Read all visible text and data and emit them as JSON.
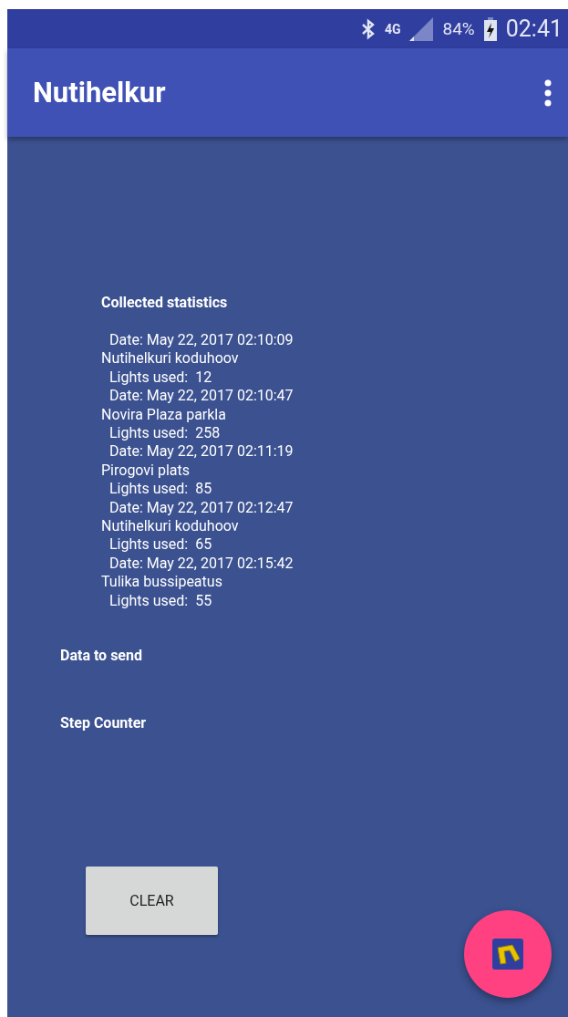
{
  "status_bar": {
    "network": "4G",
    "battery": "84%",
    "time": "02:41"
  },
  "app_bar": {
    "title": "Nutihelkur"
  },
  "statistics": {
    "title": "Collected statistics",
    "lines": [
      {
        "kind": "detail",
        "text": "Date: May 22, 2017 02:10:09"
      },
      {
        "kind": "place",
        "text": "Nutihelkuri koduhoov"
      },
      {
        "kind": "detail",
        "text": "Lights used:  12"
      },
      {
        "kind": "detail",
        "text": "Date: May 22, 2017 02:10:47"
      },
      {
        "kind": "place",
        "text": "Novira Plaza parkla"
      },
      {
        "kind": "detail",
        "text": "Lights used:  258"
      },
      {
        "kind": "detail",
        "text": "Date: May 22, 2017 02:11:19"
      },
      {
        "kind": "place",
        "text": "Pirogovi plats"
      },
      {
        "kind": "detail",
        "text": "Lights used:  85"
      },
      {
        "kind": "detail",
        "text": "Date: May 22, 2017 02:12:47"
      },
      {
        "kind": "place",
        "text": "Nutihelkuri koduhoov"
      },
      {
        "kind": "detail",
        "text": "Lights used:  65"
      },
      {
        "kind": "detail",
        "text": "Date: May 22, 2017 02:15:42"
      },
      {
        "kind": "place",
        "text": "Tulika bussipeatus"
      },
      {
        "kind": "detail",
        "text": "Lights used:  55"
      }
    ]
  },
  "sections": [
    "Data to send",
    "Step Counter"
  ],
  "clear_button": "CLEAR"
}
